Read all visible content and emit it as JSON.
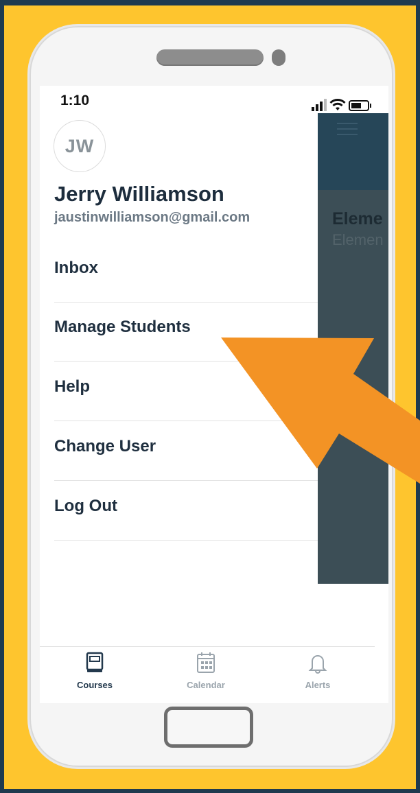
{
  "status_bar": {
    "time": "1:10"
  },
  "profile": {
    "initials": "JW",
    "name": "Jerry Williamson",
    "email": "jaustinwilliamson@gmail.com"
  },
  "menu": {
    "items": [
      {
        "label": "Inbox"
      },
      {
        "label": "Manage Students"
      },
      {
        "label": "Help"
      },
      {
        "label": "Change User"
      },
      {
        "label": "Log Out"
      }
    ]
  },
  "background_screen": {
    "title_partial": "Eleme",
    "subtitle_partial": "Elemen"
  },
  "tabs": [
    {
      "label": "Courses",
      "icon": "book-icon",
      "active": true
    },
    {
      "label": "Calendar",
      "icon": "calendar-icon",
      "active": false
    },
    {
      "label": "Alerts",
      "icon": "bell-icon",
      "active": false
    }
  ],
  "colors": {
    "frame_background": "#fec52e",
    "outer_background": "#1f3a4f",
    "arrow": "#f39325",
    "header_dark": "#264658",
    "overlay": "#3c4e56",
    "text_dark": "#1f2f3f"
  },
  "annotation": {
    "type": "arrow",
    "points_to": "Manage Students"
  }
}
